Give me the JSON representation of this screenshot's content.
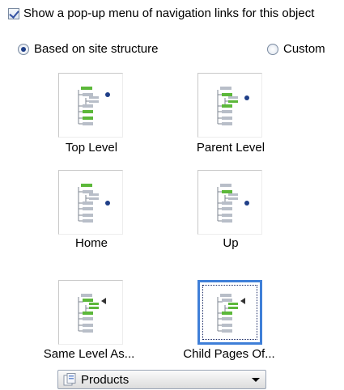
{
  "checkbox": {
    "label": "Show a pop-up menu of navigation links for this object",
    "checked": true
  },
  "radios": {
    "site_structure_label": "Based on site structure",
    "custom_label": "Custom",
    "selected": "site_structure"
  },
  "tiles": [
    {
      "label": "Top Level"
    },
    {
      "label": "Parent Level"
    },
    {
      "label": "Home"
    },
    {
      "label": "Up"
    },
    {
      "label": "Same Level As..."
    },
    {
      "label": "Child Pages Of..."
    }
  ],
  "selected_tile": "Child Pages Of...",
  "dropdown": {
    "value": "Products"
  },
  "colors": {
    "tree_green": "#5cb83a",
    "tree_gray": "#b8bec8",
    "accent_blue": "#3f7fd8",
    "dot_blue": "#1f3f88"
  }
}
